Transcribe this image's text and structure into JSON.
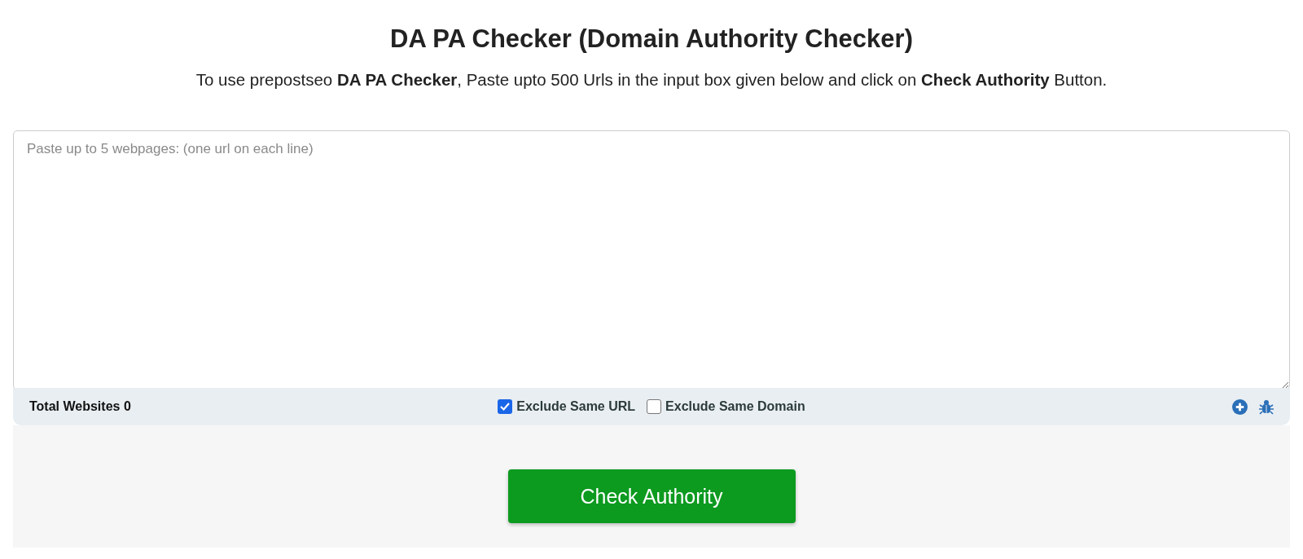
{
  "title": "DA PA Checker (Domain Authority Checker)",
  "intro": "To use prepostseo **DA PA Checker**, Paste upto 500 Urls in the input box given below and click on **Check Authority** Button.",
  "url_input": {
    "placeholder": "Paste up to 5 webpages: (one url on each line)"
  },
  "status_bar": {
    "total": "Total Websites 0",
    "options": [
      {
        "label": "Exclude Same URL",
        "checked": true
      },
      {
        "label": "Exclude Same Domain",
        "checked": false
      }
    ]
  },
  "submit_button": "Check Authority"
}
